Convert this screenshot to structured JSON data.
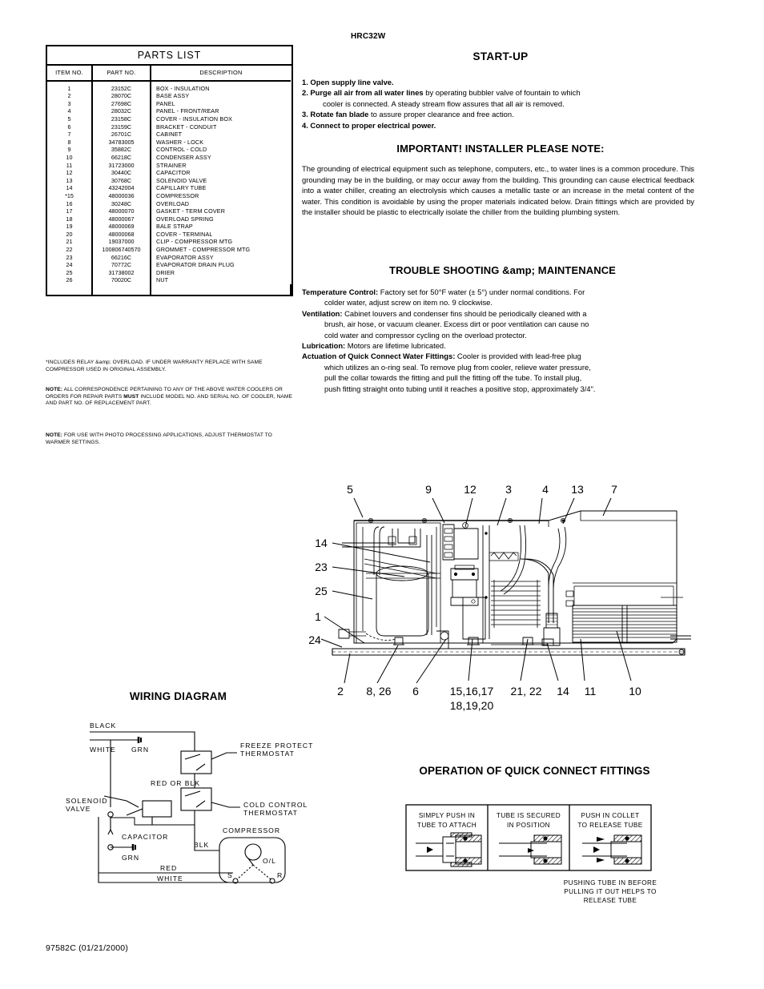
{
  "model_label": "HRC32W",
  "footer": "97582C  (01/21/2000)",
  "parts_list": {
    "title": "PARTS LIST",
    "columns": [
      "ITEM NO.",
      "PART NO.",
      "DESCRIPTION"
    ],
    "rows": [
      [
        "1",
        "23152C",
        "BOX - INSULATION"
      ],
      [
        "2",
        "28070C",
        "BASE ASSY"
      ],
      [
        "3",
        "27698C",
        "PANEL"
      ],
      [
        "4",
        "28032C",
        "PANEL - FRONT/REAR"
      ],
      [
        "5",
        "23158C",
        "COVER - INSULATION BOX"
      ],
      [
        "6",
        "23159C",
        "BRACKET - CONDUIT"
      ],
      [
        "7",
        "26701C",
        "CABINET"
      ],
      [
        "8",
        "34783005",
        "WASHER - LOCK"
      ],
      [
        "9",
        "35882C",
        "CONTROL - COLD"
      ],
      [
        "10",
        "66218C",
        "CONDENSER ASSY"
      ],
      [
        "11",
        "31723000",
        "STRAINER"
      ],
      [
        "12",
        "30440C",
        "CAPACITOR"
      ],
      [
        "13",
        "30768C",
        "SOLENOID VALVE"
      ],
      [
        "14",
        "43242004",
        "CAPILLARY TUBE"
      ],
      [
        "*15",
        "48000036",
        "COMPRESSOR"
      ],
      [
        "16",
        "30248C",
        "OVERLOAD"
      ],
      [
        "17",
        "48000070",
        "GASKET - TERM COVER"
      ],
      [
        "18",
        "48000067",
        "OVERLOAD SPRING"
      ],
      [
        "19",
        "48000069",
        "BALE STRAP"
      ],
      [
        "20",
        "48000068",
        "COVER - TERMINAL"
      ],
      [
        "21",
        "19037000",
        "CLIP - COMPRESSOR MTG"
      ],
      [
        "22",
        "100806740570",
        "GROMMET - COMPRESSOR MTG"
      ],
      [
        "23",
        "66216C",
        "EVAPORATOR ASSY"
      ],
      [
        "24",
        "70772C",
        "EVAPORATOR DRAIN PLUG"
      ],
      [
        "25",
        "31738002",
        "DRIER"
      ],
      [
        "26",
        "70020C",
        "NUT"
      ]
    ]
  },
  "notes": {
    "star": "*INCLUDES RELAY &amp; OVERLOAD. IF UNDER WARRANTY REPLACE WITH SAME COMPRESSOR USED IN ORIGINAL ASSEMBLY.",
    "correspondence_label": "NOTE:",
    "correspondence_a": " ALL CORRESPONDENCE PERTAINING TO ANY OF THE ABOVE WATER COOLERS OR ORDERS FOR REPAIR PARTS ",
    "correspondence_must": "MUST",
    "correspondence_b": " INCLUDE MODEL NO. AND SERIAL NO. OF COOLER, NAME AND PART NO. OF REPLACEMENT PART.",
    "photo_label": "NOTE:",
    "photo_text": " FOR USE WITH PHOTO PROCESSING APPLICATIONS, ADJUST THERMOSTAT TO WARMER SETTINGS."
  },
  "startup": {
    "heading": "START-UP",
    "item1_bold": "1. Open supply line valve.",
    "item2_bold": "2. Purge all air from all water lines",
    "item2_rest": " by operating bubbler valve of fountain to which",
    "item2_cont": "cooler is connected. A steady stream flow assures that all air is removed.",
    "item3_bold": "3. Rotate fan blade",
    "item3_rest": " to assure proper clearance and free action.",
    "item4_bold": "4. Connect to proper electrical power."
  },
  "installer": {
    "heading": "IMPORTANT! INSTALLER PLEASE NOTE:",
    "paragraph": "The grounding of electrical equipment such as telephone, computers, etc., to water lines is a common procedure. This grounding may be in the building, or may occur away from the building. This grounding can cause electrical feedback into a water chiller, creating an electrolysis which causes a metallic taste or an increase in the metal content of the water. This condition is avoidable by using the proper materials indicated below. Drain fittings which are provided by the installer should be plastic to electrically isolate the chiller from the building plumbing system."
  },
  "troubleshooting": {
    "heading": "TROUBLE SHOOTING &amp; MAINTENANCE",
    "temp_label": "Temperature Control:",
    "temp_text": "  Factory set for 50°F water (± 5°) under normal conditions. For",
    "temp_cont": "colder water, adjust screw on item no. 9 clockwise.",
    "vent_label": "Ventilation:",
    "vent_text": "  Cabinet louvers and condenser fins should be periodically cleaned with a",
    "vent_cont1": "brush, air hose, or vacuum cleaner. Excess dirt or poor ventilation can cause no",
    "vent_cont2": "cold water and compressor cycling on the overload protector.",
    "lub_label": "Lubrication:",
    "lub_text": "  Motors are lifetime lubricated.",
    "act_label": "Actuation of Quick Connect Water Fittings:",
    "act_text": "  Cooler is provided with lead-free plug",
    "act_cont1": "which utilizes an o-ring seal. To remove plug from cooler, relieve water pressure,",
    "act_cont2": "pull the collar towards the fitting and pull the fitting off the tube. To install plug,",
    "act_cont3": "push fitting straight onto tubing until it reaches a positive stop, approximately 3/4\"."
  },
  "assembly_diagram": {
    "callouts_top": [
      "5",
      "9",
      "12",
      "3",
      "4",
      "13",
      "7"
    ],
    "callouts_left": [
      "14",
      "23",
      "25",
      "1",
      "24"
    ],
    "callouts_bottom": [
      "2",
      "8, 26",
      "6",
      "15,16,17",
      "21, 22",
      "14",
      "11",
      "10"
    ],
    "callout_bottom_second_line": "18,19,20"
  },
  "wiring_diagram": {
    "heading": "WIRING DIAGRAM",
    "labels": {
      "black": "BLACK",
      "white_top": "WHITE",
      "grn_top": "GRN",
      "solenoid_valve_1": "SOLENOID",
      "solenoid_valve_2": "VALVE",
      "red_or_blk": "RED OR BLK",
      "freeze_1": "FREEZE PROTECT",
      "freeze_2": "THERMOSTAT",
      "cold_1": "COLD CONTROL",
      "cold_2": "THERMOSTAT",
      "capacitor": "CAPACITOR",
      "grn_bottom": "GRN",
      "blk": "BLK",
      "compressor": "COMPRESSOR",
      "ol": "O/L",
      "s": "S",
      "r": "R",
      "red_bottom": "RED",
      "white_bottom": "WHITE"
    }
  },
  "quick_connect": {
    "heading": "OPERATION OF QUICK CONNECT FITTINGS",
    "panels": [
      {
        "line1": "SIMPLY PUSH IN",
        "line2": "TUBE TO ATTACH"
      },
      {
        "line1": "TUBE IS SECURED",
        "line2": "IN POSITION"
      },
      {
        "line1": "PUSH IN COLLET",
        "line2": "TO RELEASE TUBE"
      }
    ],
    "caption": [
      "PUSHING TUBE IN BEFORE",
      "PULLING IT OUT HELPS TO",
      "RELEASE TUBE"
    ]
  }
}
